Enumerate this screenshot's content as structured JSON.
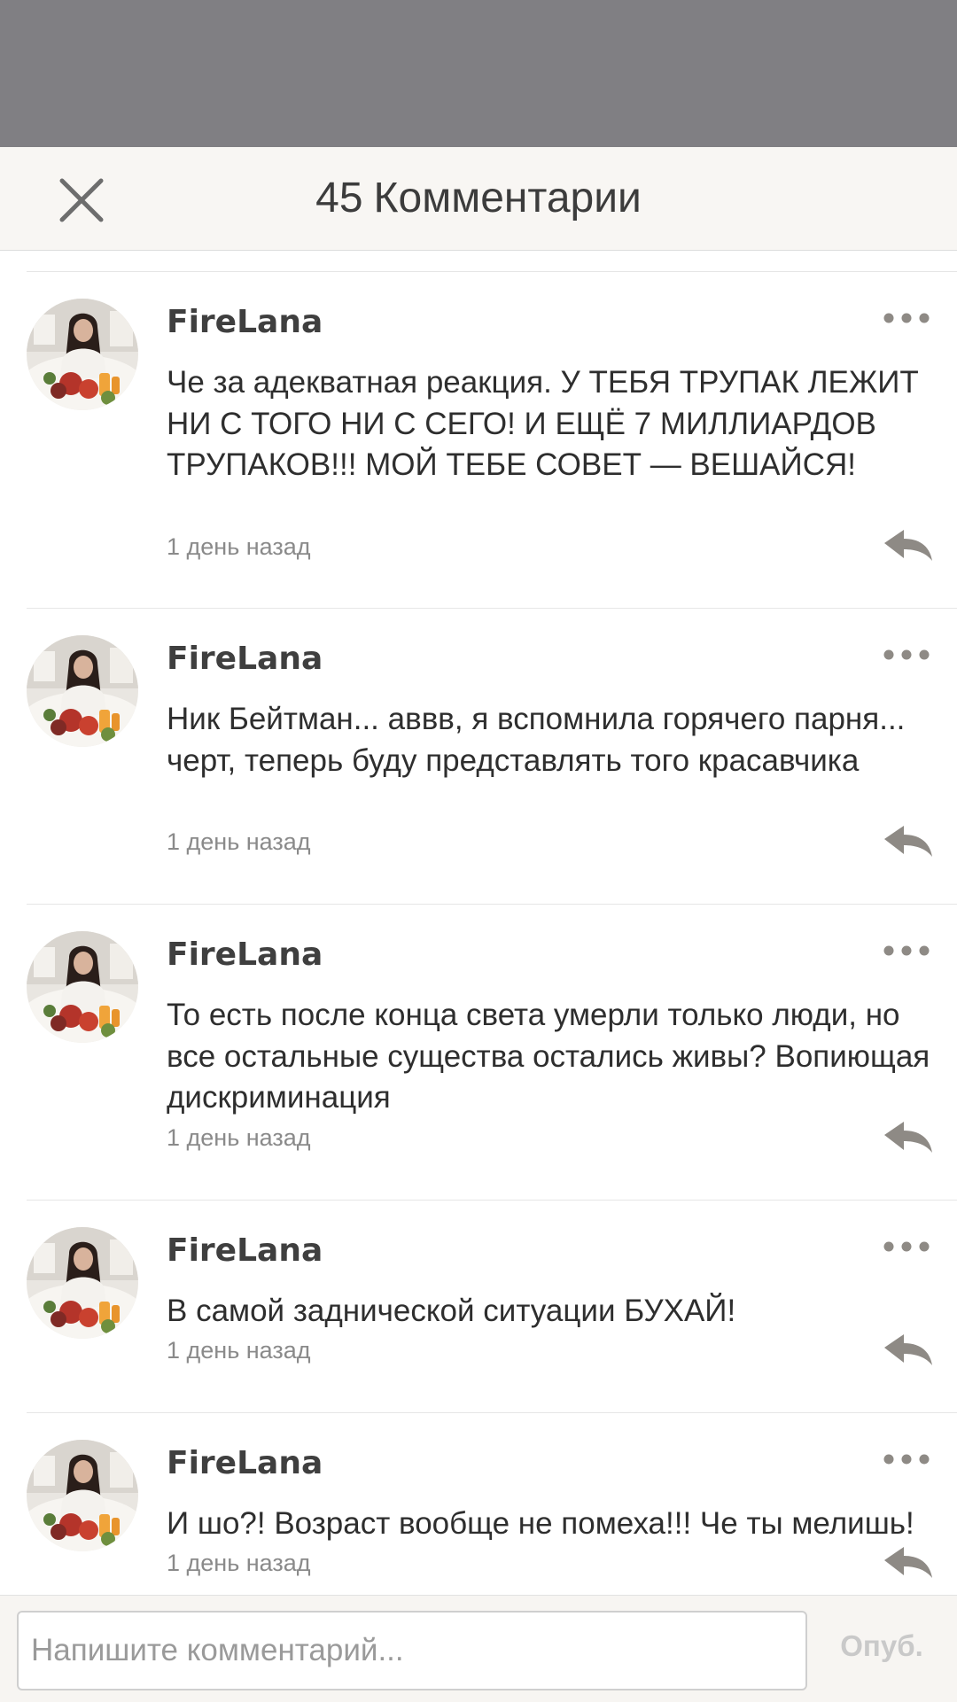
{
  "header": {
    "count": "45",
    "title": "Комментарии"
  },
  "comments": [
    {
      "author": "FireLana",
      "text": "Че за адекватная реакция. У ТЕБЯ ТРУПАК ЛЕЖИТ НИ С ТОГО НИ С СЕГО! И ЕЩЁ 7 МИЛЛИАРДОВ ТРУПАКОВ!!! МОЙ ТЕБЕ СОВЕТ — ВЕШАЙСЯ!",
      "time": "1 день назад"
    },
    {
      "author": "FireLana",
      "text": "Ник Бейтман... аввв, я вспомнила горячего парня... черт, теперь буду представлять того красавчика",
      "time": "1 день назад"
    },
    {
      "author": "FireLana",
      "text": "То есть после конца света умерли только люди, но все остальные существа остались живы? Вопиющая дискриминация",
      "time": "1 день назад"
    },
    {
      "author": "FireLana",
      "text": "В самой заднической ситуации БУХАЙ!",
      "time": "1 день назад"
    },
    {
      "author": "FireLana",
      "text": "И шо?! Возраст вообще не помеха!!! Че ты мелишь!",
      "time": "1 день назад"
    }
  ],
  "composer": {
    "placeholder": "Напишите комментарий...",
    "publish_label": "Опуб."
  },
  "icons": {
    "close": "close-icon",
    "more": "more-icon",
    "reply": "reply-icon",
    "avatar": "avatar"
  },
  "colors": {
    "overlay": "#807f83",
    "header_bg": "#f8f6f3",
    "icon_gray": "#8e8a85",
    "publish_disabled": "#c9c9c9"
  }
}
